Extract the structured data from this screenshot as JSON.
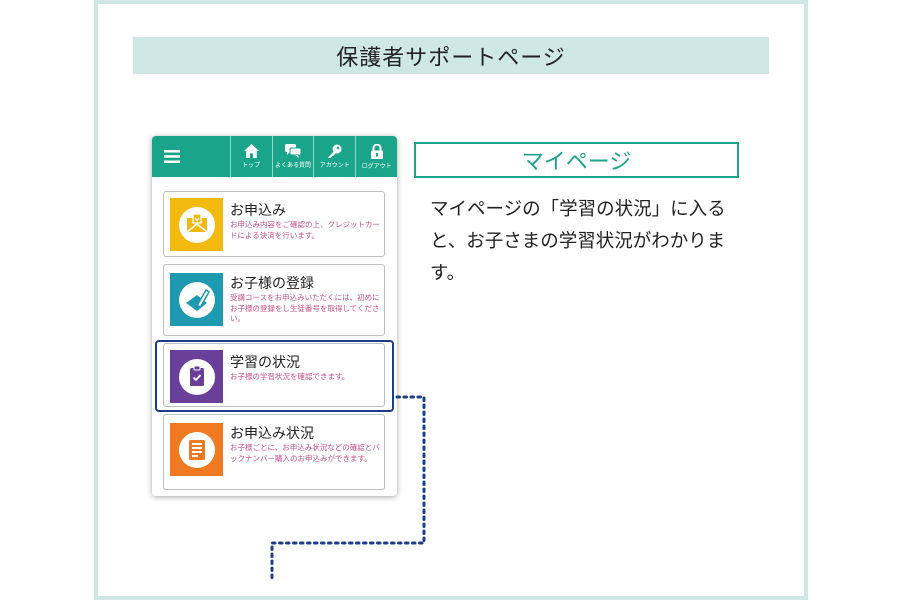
{
  "page": {
    "title": "保護者サポートページ"
  },
  "nav": {
    "items": [
      {
        "label": "トップ",
        "icon": "home-icon"
      },
      {
        "label": "よくある質問",
        "icon": "chat-icon"
      },
      {
        "label": "アカウント",
        "icon": "key-icon"
      },
      {
        "label": "ログアウト",
        "icon": "lock-icon"
      }
    ]
  },
  "menu": {
    "items": [
      {
        "title": "お申込み",
        "desc": "お申込み内容をご確認の上、クレジットカードによる決済を行います。",
        "icon": "envelope-icon",
        "color": "#f2b90f"
      },
      {
        "title": "お子様の登録",
        "desc": "受講コースをお申込みいただくには、初めにお子様の登録をし生徒番号を取得してください。",
        "icon": "pen-icon",
        "color": "#1e9ab0"
      },
      {
        "title": "学習の状況",
        "desc": "お子様の学習状況を確認できます。",
        "icon": "clipboard-check-icon",
        "color": "#6a3f9a"
      },
      {
        "title": "お申込み状況",
        "desc": "お子様ごとに、お申込み状況などの確認とバックナンバー購入のお申込みができます。",
        "icon": "document-icon",
        "color": "#f07a21"
      }
    ]
  },
  "callout": {
    "heading": "マイページ",
    "body": "マイページの「学習の状況」に入ると、お子さまの学習状況がわかります。"
  },
  "colors": {
    "accent": "#1aa58b",
    "band": "#cfe8e4",
    "highlight": "#1c3d8c",
    "desc": "#c94f8a"
  }
}
